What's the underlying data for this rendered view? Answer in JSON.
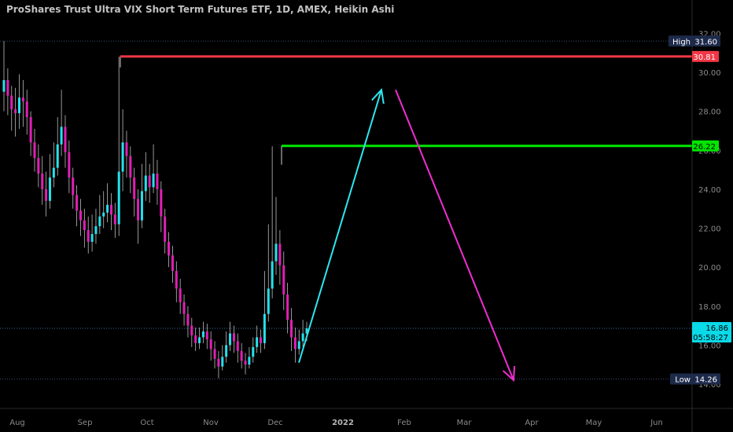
{
  "chart_data": {
    "type": "candlestick",
    "title": "ProShares Trust Ultra VIX Short Term Futures ETF, 1D, AMEX, Heikin Ashi",
    "x_labels": [
      "Aug",
      "Sep",
      "Oct",
      "Nov",
      "Dec",
      "2022",
      "Feb",
      "Mar",
      "Apr",
      "May",
      "Jun"
    ],
    "y_ticks": [
      "32.00",
      "30.00",
      "28.00",
      "26.00",
      "24.00",
      "22.00",
      "20.00",
      "18.00",
      "16.00",
      "14.00"
    ],
    "ylim": [
      14.0,
      32.0
    ],
    "grid": false,
    "high": {
      "label": "High",
      "value": "31.60"
    },
    "low": {
      "label": "Low",
      "value": "14.26"
    },
    "current": {
      "value": "16.86",
      "countdown": "05:58:27"
    },
    "resistance_levels": [
      {
        "value": "30.81",
        "color": "#f23645"
      },
      {
        "value": "26.22",
        "color": "#00e600"
      }
    ],
    "projection_up": {
      "from_value": 15.1,
      "to_value": 29.1,
      "color": "#2ee6f0"
    },
    "projection_down": {
      "from_value": 29.1,
      "to_value": 14.2,
      "color": "#f02ed0"
    },
    "candles_note": "Heikin Ashi daily candles, cyan = up, magenta = down",
    "candles": [
      [
        29.0,
        29.6,
        31.6,
        28.0
      ],
      [
        29.6,
        28.8,
        30.2,
        27.8
      ],
      [
        28.8,
        28.1,
        29.3,
        27.0
      ],
      [
        28.1,
        27.9,
        29.2,
        26.7
      ],
      [
        27.9,
        28.7,
        29.9,
        27.1
      ],
      [
        28.7,
        28.5,
        29.6,
        27.2
      ],
      [
        28.5,
        27.7,
        29.1,
        26.8
      ],
      [
        27.7,
        26.4,
        28.0,
        25.7
      ],
      [
        26.4,
        25.6,
        27.1,
        24.9
      ],
      [
        25.6,
        24.8,
        26.3,
        24.1
      ],
      [
        24.8,
        24.0,
        25.7,
        23.2
      ],
      [
        24.0,
        23.4,
        24.9,
        22.6
      ],
      [
        23.4,
        24.6,
        25.8,
        23.0
      ],
      [
        24.6,
        25.1,
        26.4,
        24.1
      ],
      [
        25.1,
        26.3,
        27.7,
        24.7
      ],
      [
        26.3,
        27.2,
        29.1,
        25.7
      ],
      [
        27.2,
        25.9,
        27.8,
        25.1
      ],
      [
        25.9,
        24.6,
        26.5,
        23.8
      ],
      [
        24.6,
        23.7,
        25.1,
        23.0
      ],
      [
        23.7,
        22.9,
        24.2,
        22.1
      ],
      [
        22.9,
        22.4,
        23.5,
        21.6
      ],
      [
        22.4,
        21.9,
        23.0,
        21.0
      ],
      [
        21.9,
        21.3,
        22.6,
        20.7
      ],
      [
        21.3,
        21.7,
        22.7,
        20.8
      ],
      [
        21.7,
        22.1,
        23.0,
        21.2
      ],
      [
        22.1,
        22.6,
        23.7,
        21.7
      ],
      [
        22.6,
        22.8,
        23.9,
        22.0
      ],
      [
        22.8,
        23.2,
        24.3,
        22.3
      ],
      [
        23.2,
        22.7,
        23.8,
        21.9
      ],
      [
        22.7,
        22.2,
        23.3,
        21.5
      ],
      [
        22.2,
        24.9,
        30.8,
        21.6
      ],
      [
        24.9,
        26.4,
        28.1,
        23.9
      ],
      [
        26.4,
        25.7,
        27.0,
        24.6
      ],
      [
        25.7,
        24.6,
        26.2,
        23.8
      ],
      [
        24.6,
        23.5,
        25.1,
        22.6
      ],
      [
        23.5,
        22.4,
        24.0,
        21.2
      ],
      [
        22.4,
        23.9,
        25.3,
        22.0
      ],
      [
        23.9,
        24.7,
        25.9,
        23.4
      ],
      [
        24.7,
        24.1,
        25.3,
        23.3
      ],
      [
        24.1,
        24.8,
        26.3,
        23.8
      ],
      [
        24.8,
        24.0,
        25.5,
        23.2
      ],
      [
        24.0,
        22.6,
        24.4,
        21.8
      ],
      [
        22.6,
        21.3,
        23.0,
        20.7
      ],
      [
        21.3,
        20.6,
        21.8,
        20.0
      ],
      [
        20.6,
        19.8,
        21.1,
        19.2
      ],
      [
        19.8,
        18.9,
        20.3,
        18.2
      ],
      [
        18.9,
        18.2,
        19.4,
        17.6
      ],
      [
        18.2,
        17.6,
        18.6,
        17.0
      ],
      [
        17.6,
        17.0,
        18.0,
        16.4
      ],
      [
        17.0,
        16.5,
        17.4,
        15.9
      ],
      [
        16.5,
        16.1,
        16.9,
        15.7
      ],
      [
        16.1,
        16.4,
        16.9,
        15.8
      ],
      [
        16.4,
        16.7,
        17.2,
        16.1
      ],
      [
        16.7,
        16.3,
        17.1,
        15.8
      ],
      [
        16.3,
        15.8,
        16.7,
        15.2
      ],
      [
        15.8,
        15.3,
        16.2,
        14.8
      ],
      [
        15.3,
        14.9,
        15.7,
        14.3
      ],
      [
        14.9,
        15.4,
        16.0,
        14.7
      ],
      [
        15.4,
        16.0,
        16.7,
        15.1
      ],
      [
        16.0,
        16.6,
        17.2,
        15.7
      ],
      [
        16.6,
        16.2,
        17.0,
        15.6
      ],
      [
        16.2,
        15.7,
        16.6,
        15.1
      ],
      [
        15.7,
        15.2,
        16.1,
        14.8
      ],
      [
        15.2,
        15.0,
        15.6,
        14.5
      ],
      [
        15.0,
        15.4,
        15.9,
        14.8
      ],
      [
        15.4,
        15.9,
        16.4,
        15.1
      ],
      [
        15.9,
        16.4,
        17.0,
        15.6
      ],
      [
        16.4,
        16.1,
        16.8,
        15.6
      ],
      [
        16.1,
        17.6,
        19.8,
        15.8
      ],
      [
        17.6,
        18.9,
        22.2,
        17.2
      ],
      [
        18.9,
        20.3,
        26.2,
        18.4
      ],
      [
        20.3,
        21.2,
        23.6,
        19.6
      ],
      [
        21.2,
        20.1,
        21.9,
        19.1
      ],
      [
        20.1,
        18.6,
        20.8,
        17.8
      ],
      [
        18.6,
        17.3,
        19.2,
        16.6
      ],
      [
        17.3,
        16.4,
        17.9,
        15.7
      ],
      [
        16.4,
        15.8,
        16.9,
        15.1
      ],
      [
        15.8,
        16.2,
        16.8,
        15.5
      ],
      [
        16.2,
        16.6,
        17.3,
        15.9
      ],
      [
        16.6,
        16.86,
        17.2,
        16.2
      ]
    ]
  }
}
